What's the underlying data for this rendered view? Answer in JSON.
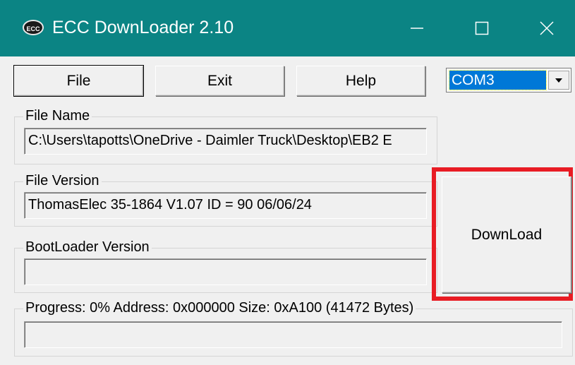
{
  "window": {
    "title": "ECC DownLoader 2.10",
    "icon": "ecc-app-icon",
    "icon_text": "ECC",
    "titlebar_color": "#0b8484"
  },
  "toolbar": {
    "file_label": "File",
    "exit_label": "Exit",
    "help_label": "Help"
  },
  "port": {
    "selected": "COM3",
    "selection_color": "#0078d7"
  },
  "file_name": {
    "label": "File Name",
    "value": "C:\\Users\\tapotts\\OneDrive - Daimler Truck\\Desktop\\EB2 E"
  },
  "file_version": {
    "label": "File Version",
    "value": "ThomasElec 35-1864 V1.07  ID = 90 06/06/24"
  },
  "bootloader_version": {
    "label": "BootLoader Version",
    "value": ""
  },
  "progress": {
    "label": "Progress:     0%  Address: 0x000000  Size: 0xA100 (41472 Bytes)",
    "percent": 0
  },
  "download": {
    "label": "DownLoad",
    "highlight_color": "#e81c24"
  }
}
